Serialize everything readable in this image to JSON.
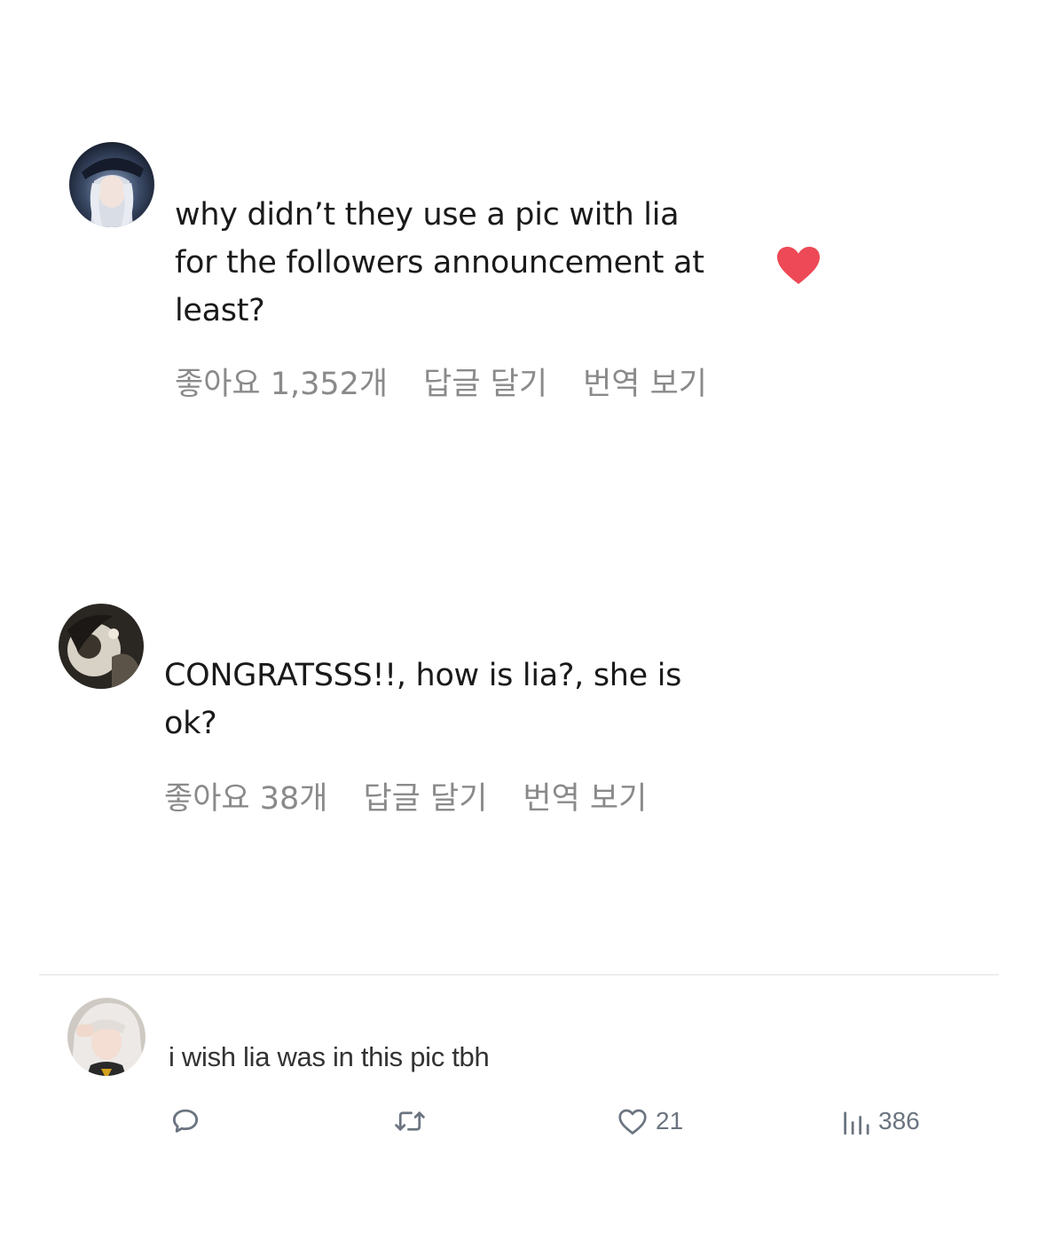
{
  "comments": [
    {
      "text_lines": [
        "why didn’t they use a pic with lia",
        "for the followers announcement at",
        "least?"
      ],
      "likes_label": "좋아요 1,352개",
      "reply_label": "답글 달기",
      "translate_label": "번역 보기",
      "liked": true,
      "heart_color": "#ed4956"
    },
    {
      "text_lines": [
        "CONGRATSSS!!, how is lia?, she is",
        "ok?"
      ],
      "likes_label": "좋아요 38개",
      "reply_label": "답글 달기",
      "translate_label": "번역 보기",
      "liked": false
    }
  ],
  "tweet": {
    "text": "i wish lia was in this pic tbh",
    "actions": {
      "reply_icon": "reply-bubble-icon",
      "retweet_icon": "retweet-icon",
      "like_icon": "heart-outline-icon",
      "like_count": "21",
      "views_icon": "views-bar-chart-icon",
      "views_count": "386"
    },
    "icon_color": "#6b7480"
  }
}
